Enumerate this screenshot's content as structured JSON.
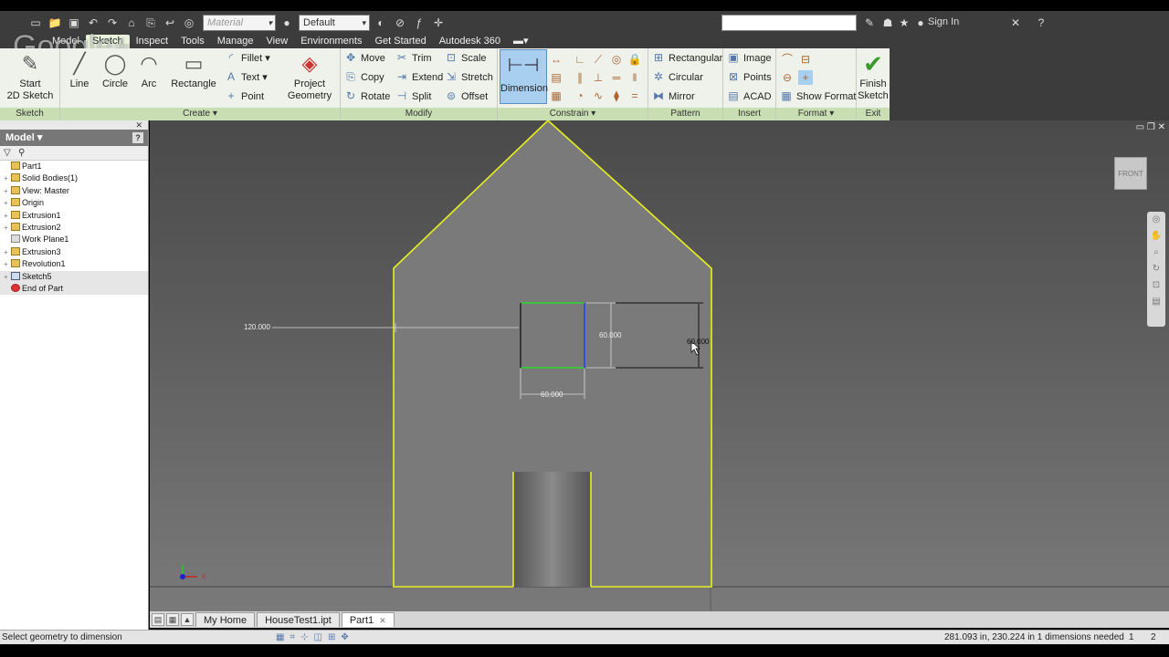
{
  "toolbar": {
    "material_placeholder": "Material",
    "appearance_value": "Default",
    "signin_label": "Sign In"
  },
  "tabs": [
    "Model",
    "Sketch",
    "Inspect",
    "Tools",
    "Manage",
    "View",
    "Environments",
    "Get Started",
    "Autodesk 360"
  ],
  "active_tab": "Sketch",
  "ribbon": {
    "sketch_panel": {
      "title": "Sketch",
      "start_label_1": "Start",
      "start_label_2": "2D Sketch"
    },
    "create_panel": {
      "title": "Create ▾",
      "line": "Line",
      "circle": "Circle",
      "arc": "Arc",
      "rectangle": "Rectangle",
      "fillet": "Fillet",
      "text": "Text",
      "point": "Point",
      "project_1": "Project",
      "project_2": "Geometry"
    },
    "modify_panel": {
      "title": "Modify",
      "move": "Move",
      "copy": "Copy",
      "rotate": "Rotate",
      "trim": "Trim",
      "extend": "Extend",
      "split": "Split",
      "scale": "Scale",
      "stretch": "Stretch",
      "offset": "Offset"
    },
    "constrain_panel": {
      "title": "Constrain ▾",
      "dimension": "Dimension"
    },
    "pattern_panel": {
      "title": "Pattern",
      "rectangular": "Rectangular",
      "circular": "Circular",
      "mirror": "Mirror"
    },
    "insert_panel": {
      "title": "Insert",
      "image": "Image",
      "points": "Points",
      "acad": "ACAD"
    },
    "format_panel": {
      "title": "Format ▾",
      "show_format": "Show Format"
    },
    "exit_panel": {
      "title": "Exit",
      "finish_1": "Finish",
      "finish_2": "Sketch"
    }
  },
  "browser": {
    "header": "Model ▾",
    "tree": [
      {
        "label": "Part1",
        "expand": ""
      },
      {
        "label": "Solid Bodies(1)",
        "expand": "+"
      },
      {
        "label": "View: Master",
        "expand": "+"
      },
      {
        "label": "Origin",
        "expand": "+"
      },
      {
        "label": "Extrusion1",
        "expand": "+"
      },
      {
        "label": "Extrusion2",
        "expand": "+"
      },
      {
        "label": "Work Plane1",
        "expand": ""
      },
      {
        "label": "Extrusion3",
        "expand": "+"
      },
      {
        "label": "Revolution1",
        "expand": "+"
      },
      {
        "label": "Sketch5",
        "expand": "+"
      },
      {
        "label": "End of Part",
        "expand": ""
      }
    ]
  },
  "viewport": {
    "viewcube_label": "FRONT",
    "dim_horizontal_offset": "120.000",
    "dim_height_inner": "60.000",
    "dim_height_outer": "60.000",
    "dim_width": "60.000",
    "colors": {
      "profile": "#e8f020",
      "constrained": "#40c040",
      "selected": "#3050e0"
    }
  },
  "doc_tabs": [
    "My Home",
    "HouseTest1.ipt",
    "Part1"
  ],
  "status": {
    "message": "Select geometry to dimension",
    "coords": "281.093 in, 230.224 in  1 dimensions needed",
    "n1": "1",
    "n2": "2"
  },
  "overlay": {
    "watermark": "Google+"
  }
}
